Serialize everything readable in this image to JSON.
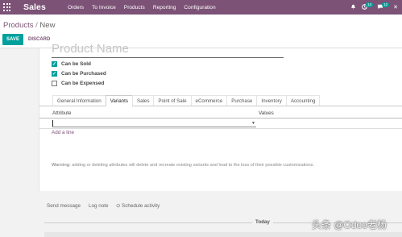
{
  "navbar": {
    "brand": "Sales",
    "menu": [
      "Orders",
      "To Invoice",
      "Products",
      "Reporting",
      "Configuration"
    ],
    "activity_count": "14",
    "message_count": "12",
    "close_glyph": "✕"
  },
  "control": {
    "breadcrumb_parent": "Products",
    "breadcrumb_sep": "/",
    "breadcrumb_current": "New",
    "save_label": "SAVE",
    "discard_label": "DISCARD"
  },
  "form": {
    "name_placeholder": "Product Name",
    "checkboxes": [
      {
        "label": "Can be Sold",
        "checked": true
      },
      {
        "label": "Can be Purchased",
        "checked": true
      },
      {
        "label": "Can be Expensed",
        "checked": false
      }
    ],
    "tabs": [
      "General Information",
      "Variants",
      "Sales",
      "Point of Sale",
      "eCommerce",
      "Purchase",
      "Inventory",
      "Accounting"
    ],
    "active_tab": "Variants",
    "columns": {
      "attribute": "Attribute",
      "values": "Values"
    },
    "add_line": "Add a line",
    "warning_label": "Warning",
    "warning_text": ": adding or deleting attributes will delete and recreate existing variants and lead to the loss of their possible customizations."
  },
  "chatter": {
    "send_message": "Send message",
    "log_note": "Log note",
    "schedule_activity": "Schedule activity",
    "clock_glyph": "⊙",
    "today": "Today"
  },
  "watermark": "头条 @Odoo老杨",
  "colors": {
    "brand": "#7c5277",
    "accent": "#00a09d"
  },
  "icons": {
    "apps": "apps-grid-icon",
    "bell": "bell-icon",
    "activity": "activity-clock-icon",
    "chat": "chat-bubble-icon",
    "close": "close-icon"
  }
}
